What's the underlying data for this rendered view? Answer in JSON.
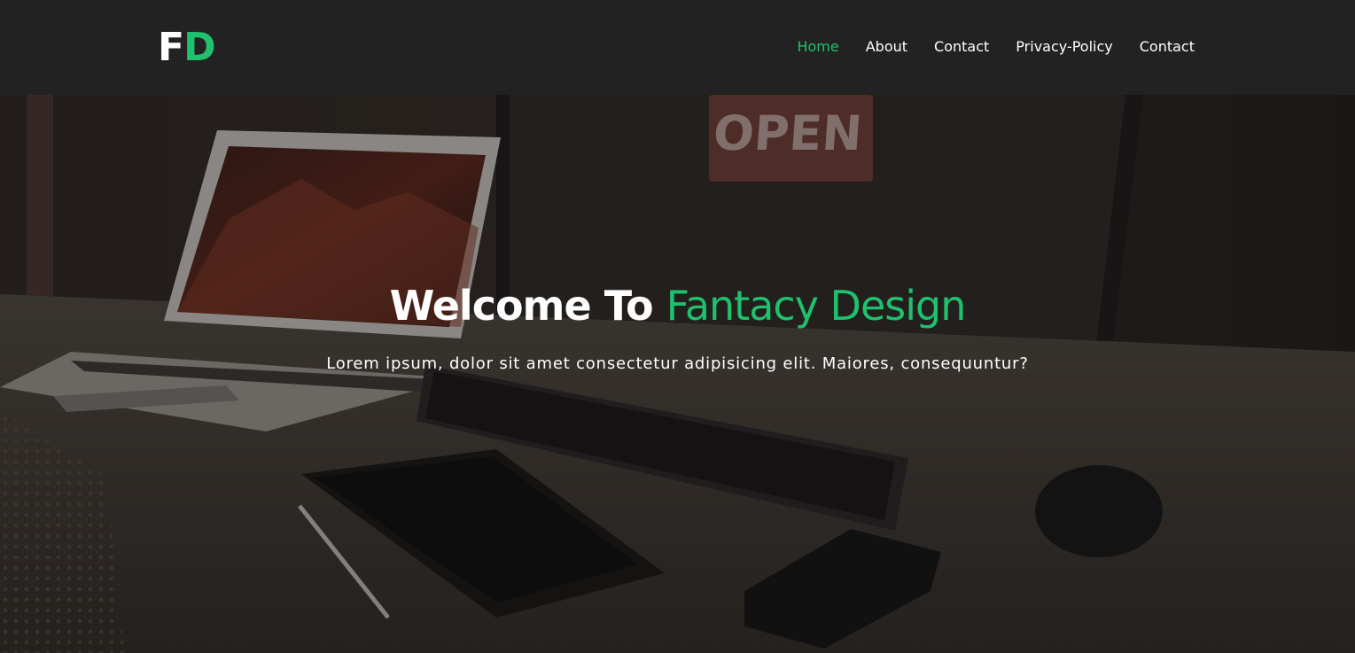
{
  "brand": {
    "logo_letter_1": "F",
    "logo_letter_2": "D",
    "accent_color": "#1fc16e"
  },
  "nav": {
    "items": [
      {
        "label": "Home",
        "active": true
      },
      {
        "label": "About",
        "active": false
      },
      {
        "label": "Contact",
        "active": false
      },
      {
        "label": "Privacy-Policy",
        "active": false
      },
      {
        "label": "Contact",
        "active": false
      }
    ]
  },
  "hero": {
    "title_part_1": "Welcome To ",
    "title_part_2": "Fantacy Design",
    "subtitle": "Lorem ipsum, dolor sit amet consectetur adipisicing elit. Maiores, consequuntur?",
    "background_image": "desk-with-laptop-keyboard-tablet-phone-and-open-sign",
    "open_sign_text": "OPEN"
  }
}
